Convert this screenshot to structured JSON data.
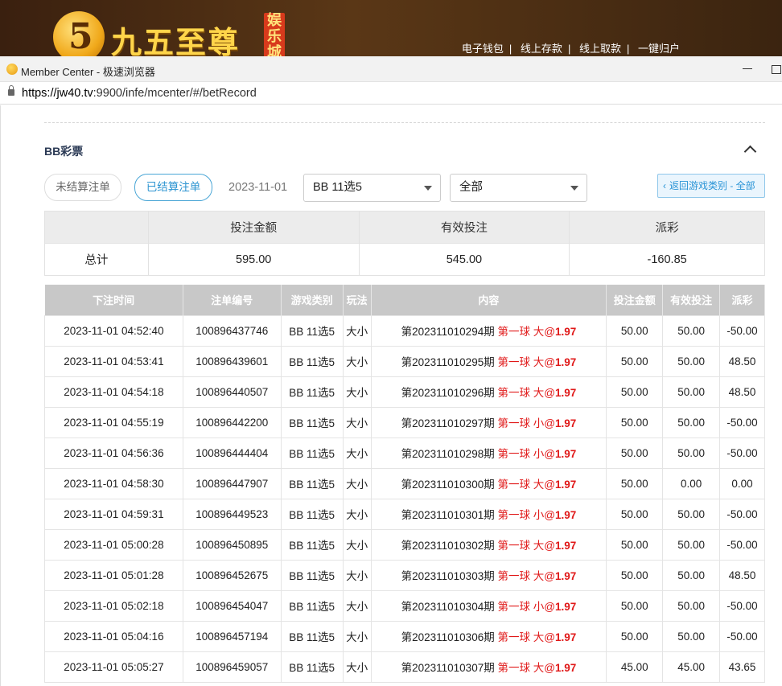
{
  "site": {
    "logo_mark": "5",
    "brand_name": "九五至尊",
    "brand_tag": "娱乐城",
    "top_links": [
      "电子钱包",
      "线上存款",
      "线上取款",
      "一键归户"
    ]
  },
  "window": {
    "title": "Member Center - 极速浏览器",
    "url_host": "https://jw40.tv",
    "url_path": ":9900/infe/mcenter/#/betRecord"
  },
  "section": {
    "title": "BB彩票"
  },
  "filters": {
    "unsettled_label": "未结算注单",
    "settled_label": "已结算注单",
    "date": "2023-11-01",
    "game_select": "BB 11选5",
    "play_select": "全部",
    "back_label": "返回游戏类别 - 全部"
  },
  "summary": {
    "headers": [
      "投注金额",
      "有效投注",
      "派彩"
    ],
    "row_label": "总计",
    "bet_amount": "595.00",
    "valid_bet": "545.00",
    "payout": "-160.85"
  },
  "records": {
    "headers": [
      "下注时间",
      "注单编号",
      "游戏类别",
      "玩法",
      "内容",
      "投注金额",
      "有效投注",
      "派彩"
    ],
    "rows": [
      {
        "time": "2023-11-01 04:52:40",
        "id": "100896437746",
        "game": "BB 11选5",
        "play": "大小",
        "period": "第202311010294期",
        "ball": "第一球 大",
        "odds": "1.97",
        "amount": "50.00",
        "valid": "50.00",
        "payout": "-50.00"
      },
      {
        "time": "2023-11-01 04:53:41",
        "id": "100896439601",
        "game": "BB 11选5",
        "play": "大小",
        "period": "第202311010295期",
        "ball": "第一球 大",
        "odds": "1.97",
        "amount": "50.00",
        "valid": "50.00",
        "payout": "48.50"
      },
      {
        "time": "2023-11-01 04:54:18",
        "id": "100896440507",
        "game": "BB 11选5",
        "play": "大小",
        "period": "第202311010296期",
        "ball": "第一球 大",
        "odds": "1.97",
        "amount": "50.00",
        "valid": "50.00",
        "payout": "48.50"
      },
      {
        "time": "2023-11-01 04:55:19",
        "id": "100896442200",
        "game": "BB 11选5",
        "play": "大小",
        "period": "第202311010297期",
        "ball": "第一球 小",
        "odds": "1.97",
        "amount": "50.00",
        "valid": "50.00",
        "payout": "-50.00"
      },
      {
        "time": "2023-11-01 04:56:36",
        "id": "100896444404",
        "game": "BB 11选5",
        "play": "大小",
        "period": "第202311010298期",
        "ball": "第一球 小",
        "odds": "1.97",
        "amount": "50.00",
        "valid": "50.00",
        "payout": "-50.00"
      },
      {
        "time": "2023-11-01 04:58:30",
        "id": "100896447907",
        "game": "BB 11选5",
        "play": "大小",
        "period": "第202311010300期",
        "ball": "第一球 大",
        "odds": "1.97",
        "amount": "50.00",
        "valid": "0.00",
        "payout": "0.00"
      },
      {
        "time": "2023-11-01 04:59:31",
        "id": "100896449523",
        "game": "BB 11选5",
        "play": "大小",
        "period": "第202311010301期",
        "ball": "第一球 小",
        "odds": "1.97",
        "amount": "50.00",
        "valid": "50.00",
        "payout": "-50.00"
      },
      {
        "time": "2023-11-01 05:00:28",
        "id": "100896450895",
        "game": "BB 11选5",
        "play": "大小",
        "period": "第202311010302期",
        "ball": "第一球 大",
        "odds": "1.97",
        "amount": "50.00",
        "valid": "50.00",
        "payout": "-50.00"
      },
      {
        "time": "2023-11-01 05:01:28",
        "id": "100896452675",
        "game": "BB 11选5",
        "play": "大小",
        "period": "第202311010303期",
        "ball": "第一球 大",
        "odds": "1.97",
        "amount": "50.00",
        "valid": "50.00",
        "payout": "48.50"
      },
      {
        "time": "2023-11-01 05:02:18",
        "id": "100896454047",
        "game": "BB 11选5",
        "play": "大小",
        "period": "第202311010304期",
        "ball": "第一球 小",
        "odds": "1.97",
        "amount": "50.00",
        "valid": "50.00",
        "payout": "-50.00"
      },
      {
        "time": "2023-11-01 05:04:16",
        "id": "100896457194",
        "game": "BB 11选5",
        "play": "大小",
        "period": "第202311010306期",
        "ball": "第一球 大",
        "odds": "1.97",
        "amount": "50.00",
        "valid": "50.00",
        "payout": "-50.00"
      },
      {
        "time": "2023-11-01 05:05:27",
        "id": "100896459057",
        "game": "BB 11选5",
        "play": "大小",
        "period": "第202311010307期",
        "ball": "第一球 大",
        "odds": "1.97",
        "amount": "45.00",
        "valid": "45.00",
        "payout": "43.65"
      }
    ]
  },
  "colors": {
    "negative": "#e43a3a",
    "accent": "#2c94d1",
    "header_gray": "#c8c8c8"
  }
}
